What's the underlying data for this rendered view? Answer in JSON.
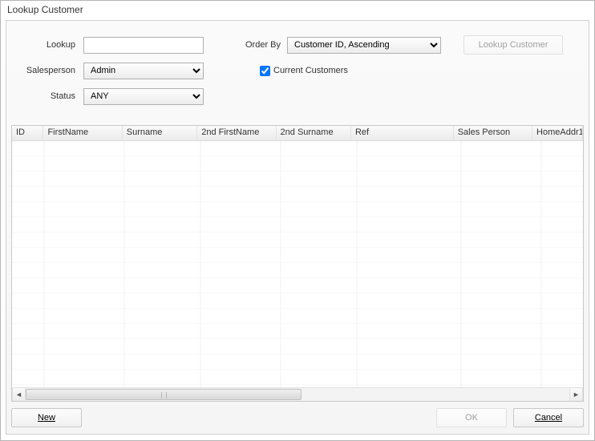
{
  "window": {
    "title": "Lookup Customer"
  },
  "form": {
    "lookup": {
      "label": "Lookup",
      "value": ""
    },
    "salesperson": {
      "label": "Salesperson",
      "value": "Admin",
      "options": [
        "Admin"
      ]
    },
    "status": {
      "label": "Status",
      "value": "ANY",
      "options": [
        "ANY"
      ]
    },
    "orderby": {
      "label": "Order By",
      "value": "Customer ID, Ascending",
      "options": [
        "Customer ID, Ascending"
      ]
    },
    "currentCustomers": {
      "label": "Current Customers",
      "checked": true
    }
  },
  "buttons": {
    "lookup": "Lookup Customer",
    "new": "New",
    "ok": "OK",
    "cancel": "Cancel"
  },
  "grid": {
    "columns": [
      "ID",
      "FirstName",
      "Surname",
      "2nd FirstName",
      "2nd Surname",
      "Ref",
      "Sales Person",
      "HomeAddr1"
    ],
    "rows": []
  }
}
